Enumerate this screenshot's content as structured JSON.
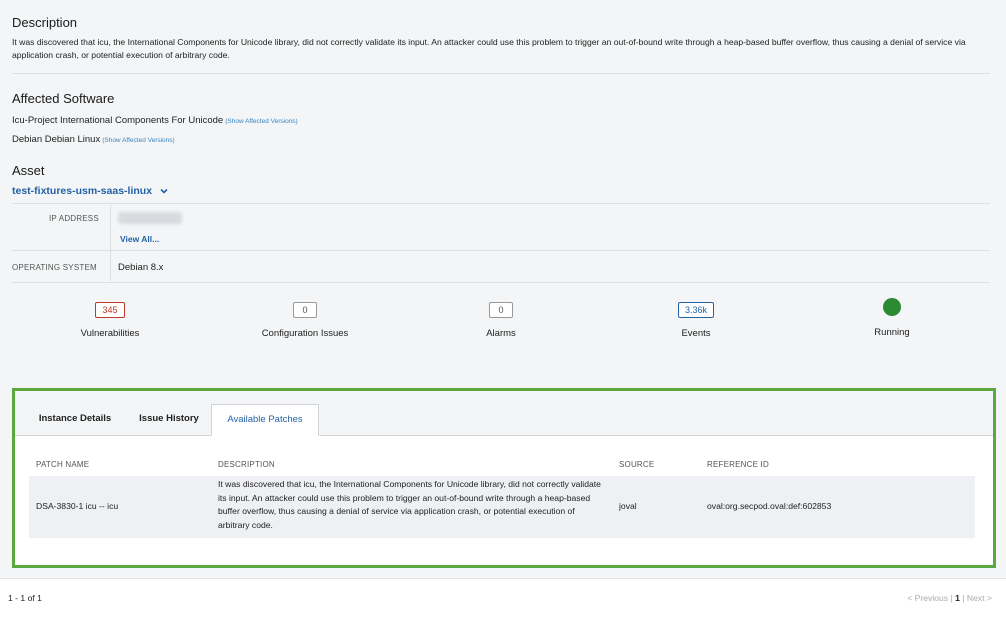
{
  "description": {
    "title": "Description",
    "text": "It was discovered that icu, the International Components for Unicode library, did not correctly validate its input. An attacker could use this problem to trigger an out-of-bound write through a heap-based buffer overflow, thus causing a denial of service via application crash, or potential execution of arbitrary code."
  },
  "affected_software": {
    "title": "Affected Software",
    "items": [
      {
        "name": "Icu-Project International Components For Unicode",
        "link": "(Show Affected Versions)"
      },
      {
        "name": "Debian Debian Linux",
        "link": "(Show Affected Versions)"
      }
    ]
  },
  "asset": {
    "title": "Asset",
    "name": "test-fixtures-usm-saas-linux",
    "ip_label": "IP ADDRESS",
    "view_all": "View All...",
    "os_label": "OPERATING SYSTEM",
    "os_value": "Debian 8.x"
  },
  "stats": [
    {
      "value": "345",
      "label": "Vulnerabilities",
      "style": "red"
    },
    {
      "value": "0",
      "label": "Configuration Issues",
      "style": "gray"
    },
    {
      "value": "0",
      "label": "Alarms",
      "style": "gray"
    },
    {
      "value": "3.36k",
      "label": "Events",
      "style": "blue"
    },
    {
      "label": "Running",
      "color": "#2b8a32"
    }
  ],
  "tabs": [
    "Instance Details",
    "Issue History",
    "Available Patches"
  ],
  "table": {
    "headers": [
      "PATCH NAME",
      "DESCRIPTION",
      "SOURCE",
      "REFERENCE ID"
    ],
    "rows": [
      {
        "patch_name": "DSA-3830-1 icu -- icu",
        "description": "It was discovered that icu, the International Components for Unicode library, did not correctly validate its input. An attacker could use this problem to trigger an out-of-bound write through a heap-based buffer overflow, thus causing a denial of service via application crash, or potential execution of arbitrary code.",
        "source": "joval",
        "reference_id": "oval:org.secpod.oval:def:602853"
      }
    ]
  },
  "footer": {
    "count": "1 - 1 of 1",
    "previous": "< Previous",
    "sep1": "|",
    "page": "1",
    "sep2": "|",
    "next": "Next >"
  },
  "colors": {
    "accent": "#2462a6",
    "highlight_border": "#5aa83f",
    "danger": "#c0392b",
    "running": "#2b8a32"
  }
}
